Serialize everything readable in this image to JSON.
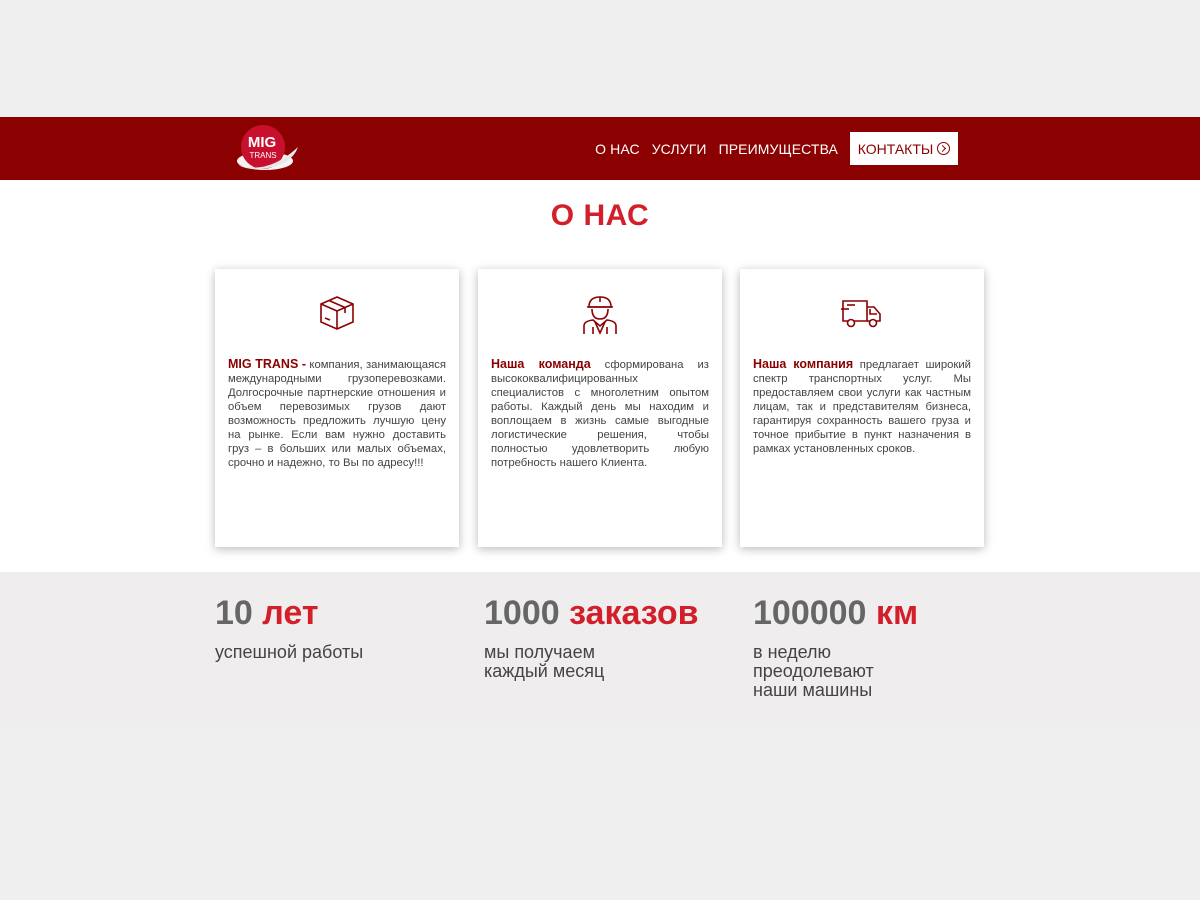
{
  "brand": {
    "logo_line1": "MIG",
    "logo_line2": "TRANS"
  },
  "nav": {
    "items": [
      "О НАС",
      "УСЛУГИ",
      "ПРЕИМУЩЕСТВА"
    ],
    "contact_label": "КОНТАКТЫ"
  },
  "about": {
    "title": "О НАС",
    "cards": [
      {
        "icon": "box-icon",
        "bold": "MIG TRANS -",
        "text": " компания, занимающаяся международными грузоперевозками. Долгосрочные партнерские отношения и объем перевозимых грузов дают возможность предложить лучшую цену на рынке. Если вам нужно доставить груз – в больших или малых объемах, срочно и надежно, то Вы по адресу!!!"
      },
      {
        "icon": "worker-icon",
        "bold": "Наша команда",
        "text": " сформирована из высококвалифицированных специалистов с многолетним опытом работы. Каждый день мы находим и воплощаем в жизнь самые выгодные логистические решения, чтобы полностью удовлетворить любую потребность нашего Клиента."
      },
      {
        "icon": "truck-icon",
        "bold": "Наша компания",
        "text": " предлагает широкий спектр транспортных услуг. Мы предоставляем свои услуги как частным лицам, так и представителям бизнеса, гарантируя сохранность вашего груза и точное прибытие в пункт назначения в рамках установленных сроков."
      }
    ]
  },
  "stats": [
    {
      "number": "10",
      "unit": "лет",
      "desc": "успешной работы"
    },
    {
      "number": "1000",
      "unit": "заказов",
      "desc": "мы получаем\nкаждый месяц"
    },
    {
      "number": "100000",
      "unit": "км",
      "desc": "в неделю\nпреодолевают\nнаши машины"
    }
  ],
  "colors": {
    "header_bg": "#8b0000",
    "accent": "#d21f2a",
    "stats_bg": "#efeded"
  }
}
